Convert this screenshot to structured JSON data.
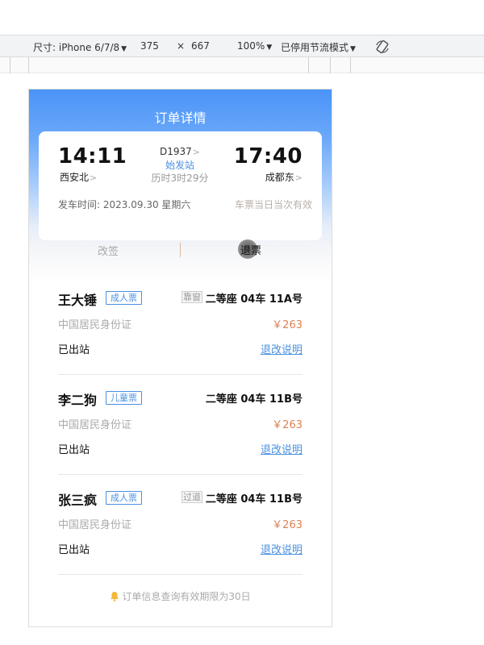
{
  "devtools": {
    "device_label": "尺寸: iPhone 6/7/8",
    "width": "375",
    "times": "×",
    "height": "667",
    "zoom": "100%",
    "throttle": "已停用节流模式",
    "rotate_icon": "rotate-icon"
  },
  "page": {
    "title": "订单详情"
  },
  "trip": {
    "depart_time": "14:11",
    "depart_station": "西安北",
    "arrive_time": "17:40",
    "arrive_station": "成都东",
    "train_no": "D1937",
    "origin_label": "始发站",
    "duration": "历时3时29分",
    "depart_date_label": "发车时间:",
    "depart_date": "2023.09.30 星期六",
    "validity": "车票当日当次有效",
    "chevron": ">"
  },
  "tabs": {
    "change": "改签",
    "refund": "退票"
  },
  "passengers": [
    {
      "name": "王大锤",
      "ticket_type": "成人票",
      "seat_tag": "靠窗",
      "seat": "二等座 04车 11A号",
      "id_type": "中国居民身份证",
      "price": "￥263",
      "status": "已出站",
      "rule_link": "退改说明"
    },
    {
      "name": "李二狗",
      "ticket_type": "儿童票",
      "seat_tag": "",
      "seat": "二等座 04车 11B号",
      "id_type": "中国居民身份证",
      "price": "￥263",
      "status": "已出站",
      "rule_link": "退改说明"
    },
    {
      "name": "张三疯",
      "ticket_type": "成人票",
      "seat_tag": "过道",
      "seat": "二等座 04车 11B号",
      "id_type": "中国居民身份证",
      "price": "￥263",
      "status": "已出站",
      "rule_link": "退改说明"
    }
  ],
  "footer": {
    "note": "订单信息查询有效期限为30日",
    "icon": "bell-icon"
  },
  "colors": {
    "accent": "#4a90e2",
    "header_blue": "#4b94f8",
    "price": "#e08050"
  }
}
